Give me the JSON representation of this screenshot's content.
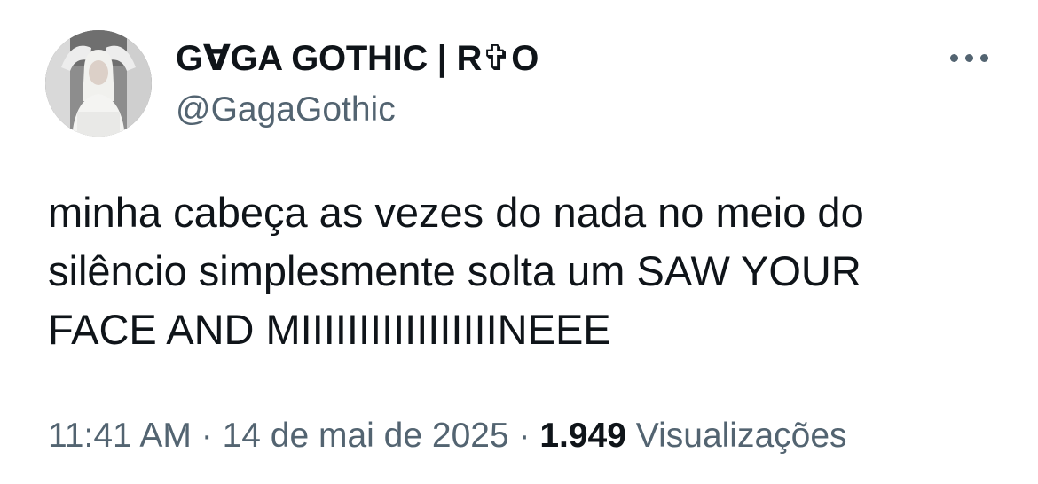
{
  "tweet": {
    "author": {
      "display_name": "G∀GA GOTHIC | R✞O",
      "handle": "@GagaGothic",
      "avatar_icon": "profile-photo"
    },
    "more_icon": "more-options-icon",
    "text": "minha cabeça as vezes do nada no meio do\nsilêncio simplesmente solta um SAW YOUR\nFACE AND MIIIIIIIIIIIIIIIIINEEE",
    "meta": {
      "time": "11:41 AM",
      "separator": " · ",
      "date": "14 de mai de 2025",
      "views_count": "1.949",
      "views_label": "Visualizações"
    }
  },
  "colors": {
    "text": "#0f1419",
    "secondary": "#536471",
    "background": "#ffffff"
  }
}
